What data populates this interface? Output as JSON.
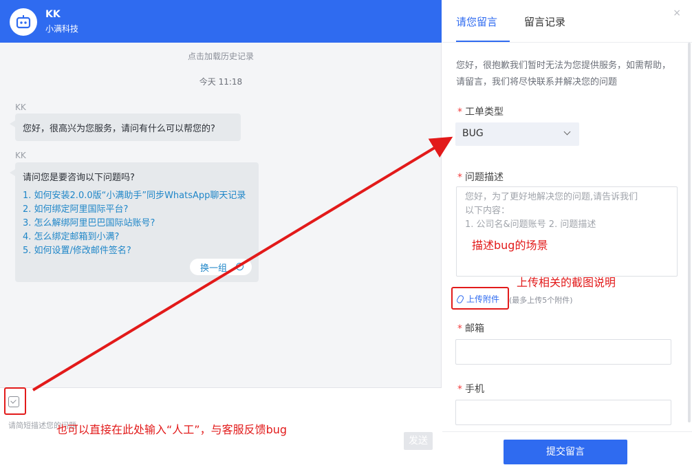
{
  "chat": {
    "agent_name": "KK",
    "company": "小满科技",
    "history_link": "点击加载历史记录",
    "time_label": "今天 11:18",
    "messages": [
      {
        "sender": "KK",
        "text": "您好，很高兴为您服务，请问有什么可以帮您的?"
      },
      {
        "sender": "KK",
        "title": "请问您是要咨询以下问题吗?",
        "links": [
          "1. 如何安装2.0.0版“小满助手”同步WhatsApp聊天记录",
          "2. 如何绑定阿里国际平台?",
          "3. 怎么解绑阿里巴巴国际站账号?",
          "4. 怎么绑定邮箱到小满?",
          "5. 如何设置/修改邮件签名?"
        ],
        "swap_label": "换一组"
      }
    ],
    "input_placeholder": "请简短描述您的问题",
    "send_label": "发送"
  },
  "panel": {
    "tabs": [
      "请您留言",
      "留言记录"
    ],
    "active_tab": "请您留言",
    "intro": "您好，很抱歉我们暂时无法为您提供服务，如需帮助，请留言，我们将尽快联系并解决您的问题",
    "ticket_type": {
      "label": "工单类型",
      "value": "BUG"
    },
    "description": {
      "label": "问题描述",
      "placeholder": "您好，为了更好地解决您的问题,请告诉我们\n以下内容：\n1. 公司名&问题账号 2. 问题描述"
    },
    "upload": {
      "label": "上传附件",
      "hint": "(最多上传5个附件)"
    },
    "email": {
      "label": "邮箱",
      "value": ""
    },
    "phone": {
      "label": "手机",
      "value": ""
    },
    "required_mark": "*",
    "submit_label": "提交留言",
    "close_glyph": "×"
  },
  "annotations": {
    "describe_scene": "描述bug的场景",
    "upload_screenshots": "上传相关的截图说明",
    "type_manual": "也可以直接在此处输入“人工”，与客服反馈bug"
  },
  "colors": {
    "brand_blue": "#2f6bf0",
    "link_blue": "#1f86c8",
    "annotation_red": "#e21a1a",
    "required_red": "#f23d3d"
  },
  "icons": [
    "robot-icon",
    "mail-icon",
    "refresh-icon",
    "chevron-down-icon",
    "paperclip-icon",
    "close-icon"
  ]
}
